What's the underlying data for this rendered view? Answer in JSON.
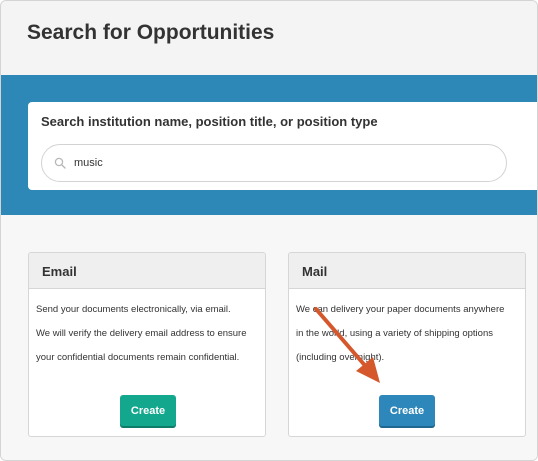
{
  "page": {
    "title": "Search for Opportunities"
  },
  "search": {
    "label": "Search institution name, position title, or position type",
    "value": "music",
    "icon": "search-icon"
  },
  "cards": [
    {
      "title": "Email",
      "lines": [
        "Send your documents electronically, via email.",
        "We will verify the delivery email address to ensure",
        "your confidential documents remain confidential."
      ],
      "button_label": "Create",
      "button_color": "#13a88e"
    },
    {
      "title": "Mail",
      "lines": [
        "We can delivery your paper documents anywhere",
        "in the world, using a variety of shipping options",
        "(including overnight)."
      ],
      "button_label": "Create",
      "button_color": "#2e87ba"
    }
  ],
  "colors": {
    "band": "#2d88b8",
    "annotation_arrow": "#d4582c"
  }
}
